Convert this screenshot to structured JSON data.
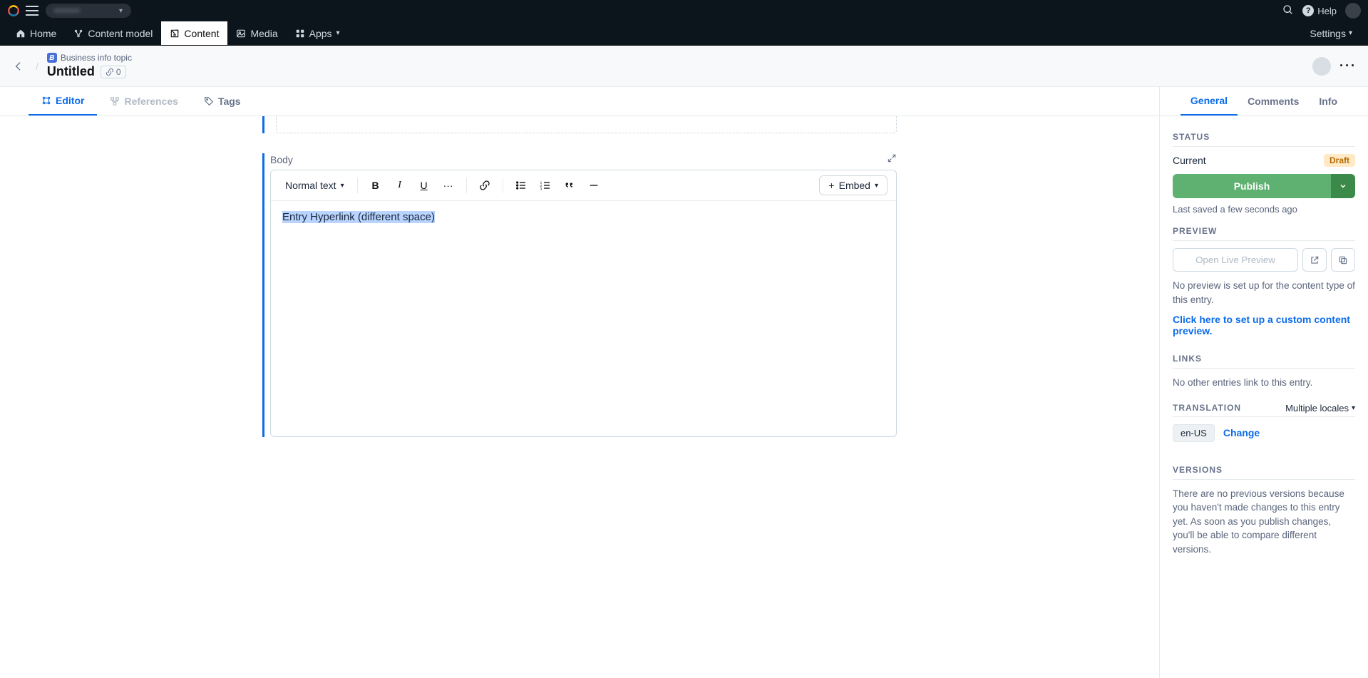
{
  "topbar": {
    "space_name": "•••••••",
    "help_label": "Help"
  },
  "nav": {
    "home": "Home",
    "content_model": "Content model",
    "content": "Content",
    "media": "Media",
    "apps": "Apps",
    "settings": "Settings"
  },
  "header": {
    "content_type": "Business info topic",
    "title": "Untitled",
    "link_count": "0"
  },
  "left_tabs": {
    "editor": "Editor",
    "references": "References",
    "tags": "Tags"
  },
  "right_tabs": {
    "general": "General",
    "comments": "Comments",
    "info": "Info"
  },
  "editor": {
    "body_label": "Body",
    "format_label": "Normal text",
    "embed_label": "Embed",
    "content_text": "Entry Hyperlink (different space)"
  },
  "sidebar": {
    "status_title": "Status",
    "current_label": "Current",
    "draft_label": "Draft",
    "publish_label": "Publish",
    "last_saved": "Last saved a few seconds ago",
    "preview_title": "Preview",
    "open_preview_label": "Open Live Preview",
    "no_preview_text": "No preview is set up for the content type of this entry.",
    "preview_link": "Click here to set up a custom content preview.",
    "links_title": "Links",
    "no_links_text": "No other entries link to this entry.",
    "translation_title": "Translation",
    "multiple_locales": "Multiple locales",
    "locale_chip": "en-US",
    "change_label": "Change",
    "versions_title": "Versions",
    "versions_text": "There are no previous versions because you haven't made changes to this entry yet. As soon as you publish changes, you'll be able to compare different versions."
  }
}
